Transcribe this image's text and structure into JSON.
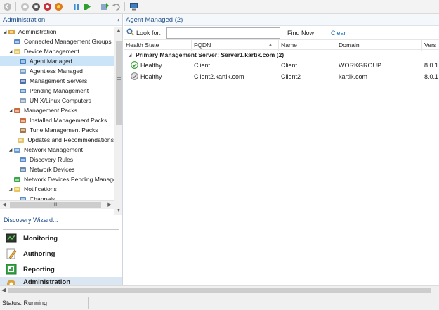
{
  "left_pane": {
    "title": "Administration",
    "collapse_glyph": "‹",
    "tree": [
      {
        "label": "Administration",
        "level": 0,
        "expanded": true,
        "icon": "gear-icon"
      },
      {
        "label": "Connected Management Groups",
        "level": 1,
        "icon": "groups-icon"
      },
      {
        "label": "Device Management",
        "level": 1,
        "expanded": true,
        "icon": "device-folder-icon"
      },
      {
        "label": "Agent Managed",
        "level": 2,
        "selected": true,
        "icon": "computer-agent-icon"
      },
      {
        "label": "Agentless Managed",
        "level": 2,
        "icon": "agentless-icon"
      },
      {
        "label": "Management Servers",
        "level": 2,
        "icon": "server-icon"
      },
      {
        "label": "Pending Management",
        "level": 2,
        "icon": "pending-icon"
      },
      {
        "label": "UNIX/Linux Computers",
        "level": 2,
        "icon": "unix-icon"
      },
      {
        "label": "Management Packs",
        "level": 1,
        "expanded": true,
        "icon": "packs-icon"
      },
      {
        "label": "Installed Management Packs",
        "level": 2,
        "icon": "installed-pack-icon"
      },
      {
        "label": "Tune Management Packs",
        "level": 2,
        "icon": "tune-pack-icon"
      },
      {
        "label": "Updates and Recommendations",
        "level": 2,
        "icon": "updates-icon"
      },
      {
        "label": "Network Management",
        "level": 1,
        "expanded": true,
        "icon": "network-folder-icon"
      },
      {
        "label": "Discovery Rules",
        "level": 2,
        "icon": "discovery-icon"
      },
      {
        "label": "Network Devices",
        "level": 2,
        "icon": "network-device-icon"
      },
      {
        "label": "Network Devices Pending Managem",
        "level": 2,
        "icon": "network-pending-icon"
      },
      {
        "label": "Notifications",
        "level": 1,
        "expanded": true,
        "icon": "folder-icon"
      },
      {
        "label": "Channels",
        "level": 2,
        "icon": "channel-icon"
      }
    ],
    "hscroll_grip": "III",
    "discovery_wizard": "Discovery Wizard...",
    "wunderbar": [
      {
        "label": "Monitoring",
        "icon": "monitoring-icon",
        "selected": false
      },
      {
        "label": "Authoring",
        "icon": "authoring-icon",
        "selected": false
      },
      {
        "label": "Reporting",
        "icon": "reporting-icon",
        "selected": false
      },
      {
        "label": "Administration",
        "icon": "administration-icon",
        "selected": true
      }
    ]
  },
  "right_pane": {
    "title": "Agent Managed (2)",
    "look_for_label": "Look for:",
    "search_value": "",
    "find_now": "Find Now",
    "clear": "Clear",
    "columns": [
      "Health State",
      "FQDN",
      "Name",
      "Domain",
      "Vers"
    ],
    "group_label": "Primary Management Server: Server1.kartik.com (2)",
    "rows": [
      {
        "health": "Healthy",
        "fqdn": "Client",
        "name": "Client",
        "domain": "WORKGROUP",
        "version": "8.0.1",
        "status_color": "#2e9e2e"
      },
      {
        "health": "Healthy",
        "fqdn": "Client2.kartik.com",
        "name": "Client2",
        "domain": "kartik.com",
        "version": "8.0.1",
        "status_color": "#8c8c8c"
      }
    ]
  },
  "status_bar": {
    "text": "Status: Running"
  },
  "colors": {
    "accent": "#1f4e8c",
    "selection": "#cce4f7",
    "link": "#1f6eb4"
  }
}
